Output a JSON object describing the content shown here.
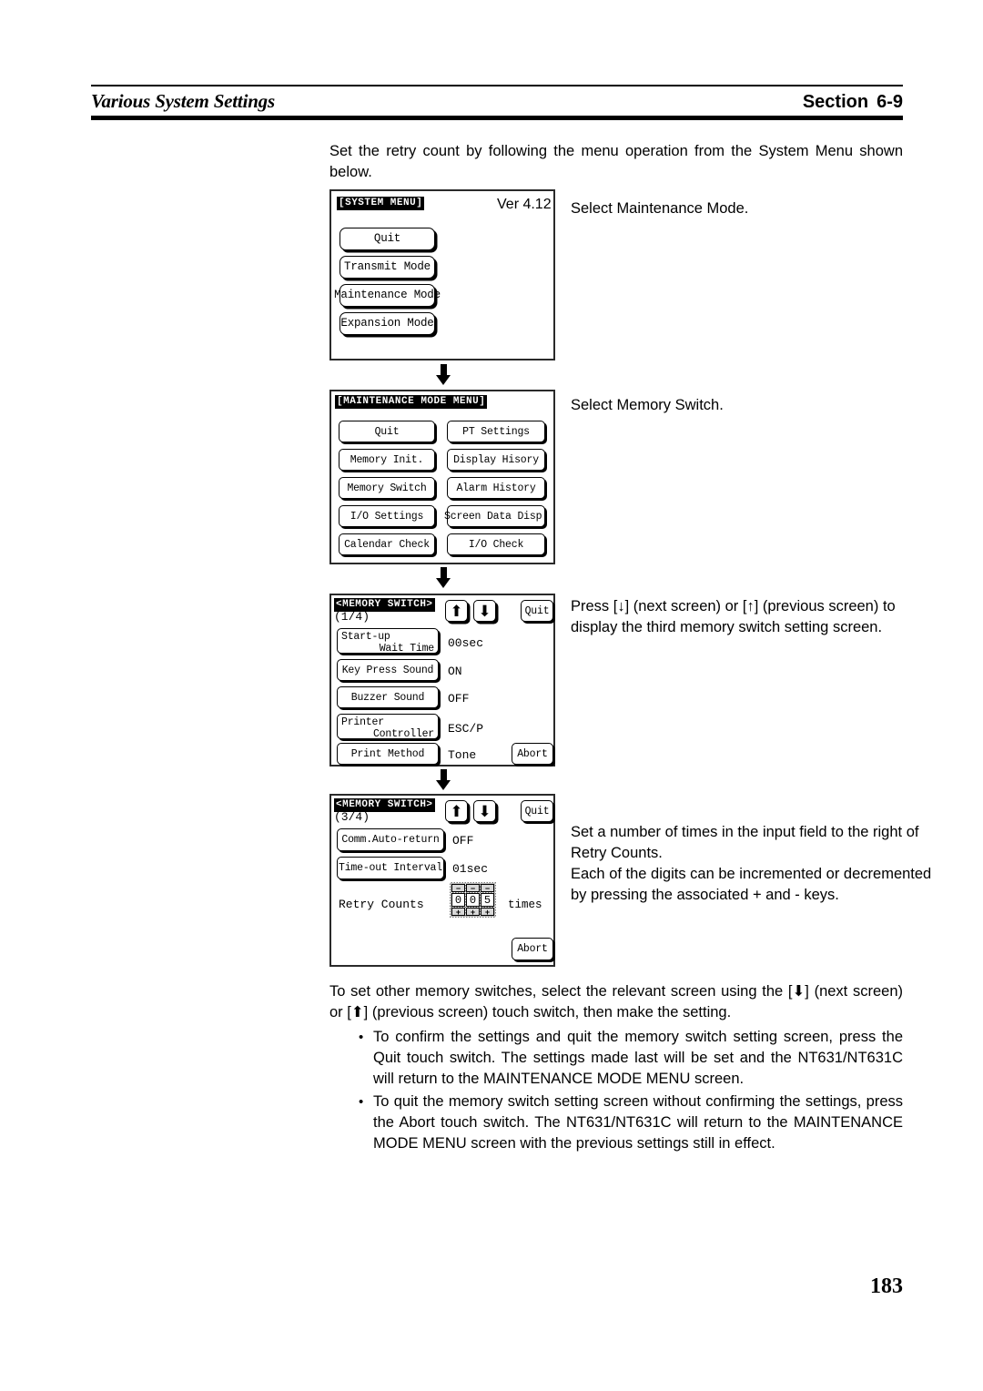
{
  "header": {
    "left_title": "Various System Settings",
    "section_label": "Section",
    "section_number": "6-9"
  },
  "intro_paragraph": "Set the retry count by following the menu operation from the System Menu shown below.",
  "annotations": {
    "step1": "Select Maintenance Mode.",
    "step2": "Select Memory Switch.",
    "step3": "Press [↓] (next screen) or [↑] (previous screen) to display the third memory switch setting screen.",
    "step4": "Set a number of times in the input field to the right of Retry Counts.\nEach of the digits can be incremented or decremented by pressing the associated + and - keys."
  },
  "screens": {
    "system_menu": {
      "title": "[SYSTEM MENU]",
      "version": "Ver 4.12",
      "buttons": [
        "Quit",
        "Transmit Mode",
        "Maintenance Mode",
        "Expansion Mode"
      ]
    },
    "maintenance_menu": {
      "title": "[MAINTENANCE MODE MENU]",
      "left_buttons": [
        "Quit",
        "Memory Init.",
        "Memory Switch",
        "I/O Settings",
        "Calendar Check"
      ],
      "right_buttons": [
        "PT Settings",
        "Display Hisory",
        "Alarm History",
        "Screen Data Disp.",
        "I/O Check"
      ]
    },
    "memory_switch_1": {
      "title": "<MEMORY SWITCH>",
      "page_indicator": "(1/4)",
      "up_arrow": "⬆",
      "down_arrow": "⬇",
      "quit_label": "Quit",
      "abort_label": "Abort",
      "rows": [
        {
          "label_line1": "Start-up",
          "label_line2": "Wait Time",
          "value": "00sec"
        },
        {
          "label_line1": "Key Press Sound",
          "label_line2": "",
          "value": "ON"
        },
        {
          "label_line1": "Buzzer Sound",
          "label_line2": "",
          "value": "OFF"
        },
        {
          "label_line1": "Printer",
          "label_line2": "Controller",
          "value": "ESC/P"
        },
        {
          "label_line1": "Print Method",
          "label_line2": "",
          "value": "Tone"
        }
      ]
    },
    "memory_switch_3": {
      "title": "<MEMORY SWITCH>",
      "page_indicator": "(3/4)",
      "up_arrow": "⬆",
      "down_arrow": "⬇",
      "quit_label": "Quit",
      "abort_label": "Abort",
      "rows": [
        {
          "label": "Comm.Auto-return",
          "value": "OFF"
        },
        {
          "label": "Time-out Interval",
          "value": "01sec"
        }
      ],
      "retry": {
        "label": "Retry Counts",
        "digits": [
          "0",
          "0",
          "5"
        ],
        "minus_key": "−",
        "plus_key": "+",
        "unit": "times"
      }
    }
  },
  "closing": {
    "paragraph": "To set other memory switches, select the relevant screen using the [⬇] (next screen) or [⬆] (previous screen) touch switch, then make the setting.",
    "bullets": [
      "To confirm the settings and quit the memory switch setting screen, press the Quit touch switch. The settings made last will be set and the NT631/NT631C will return to the MAINTENANCE MODE MENU screen.",
      "To quit the memory switch setting screen without confirming the settings, press the Abort touch switch. The NT631/NT631C will return to the MAINTENANCE MODE MENU screen with the previous settings still in effect."
    ],
    "bullet_marker": "•"
  },
  "page_number": "183"
}
